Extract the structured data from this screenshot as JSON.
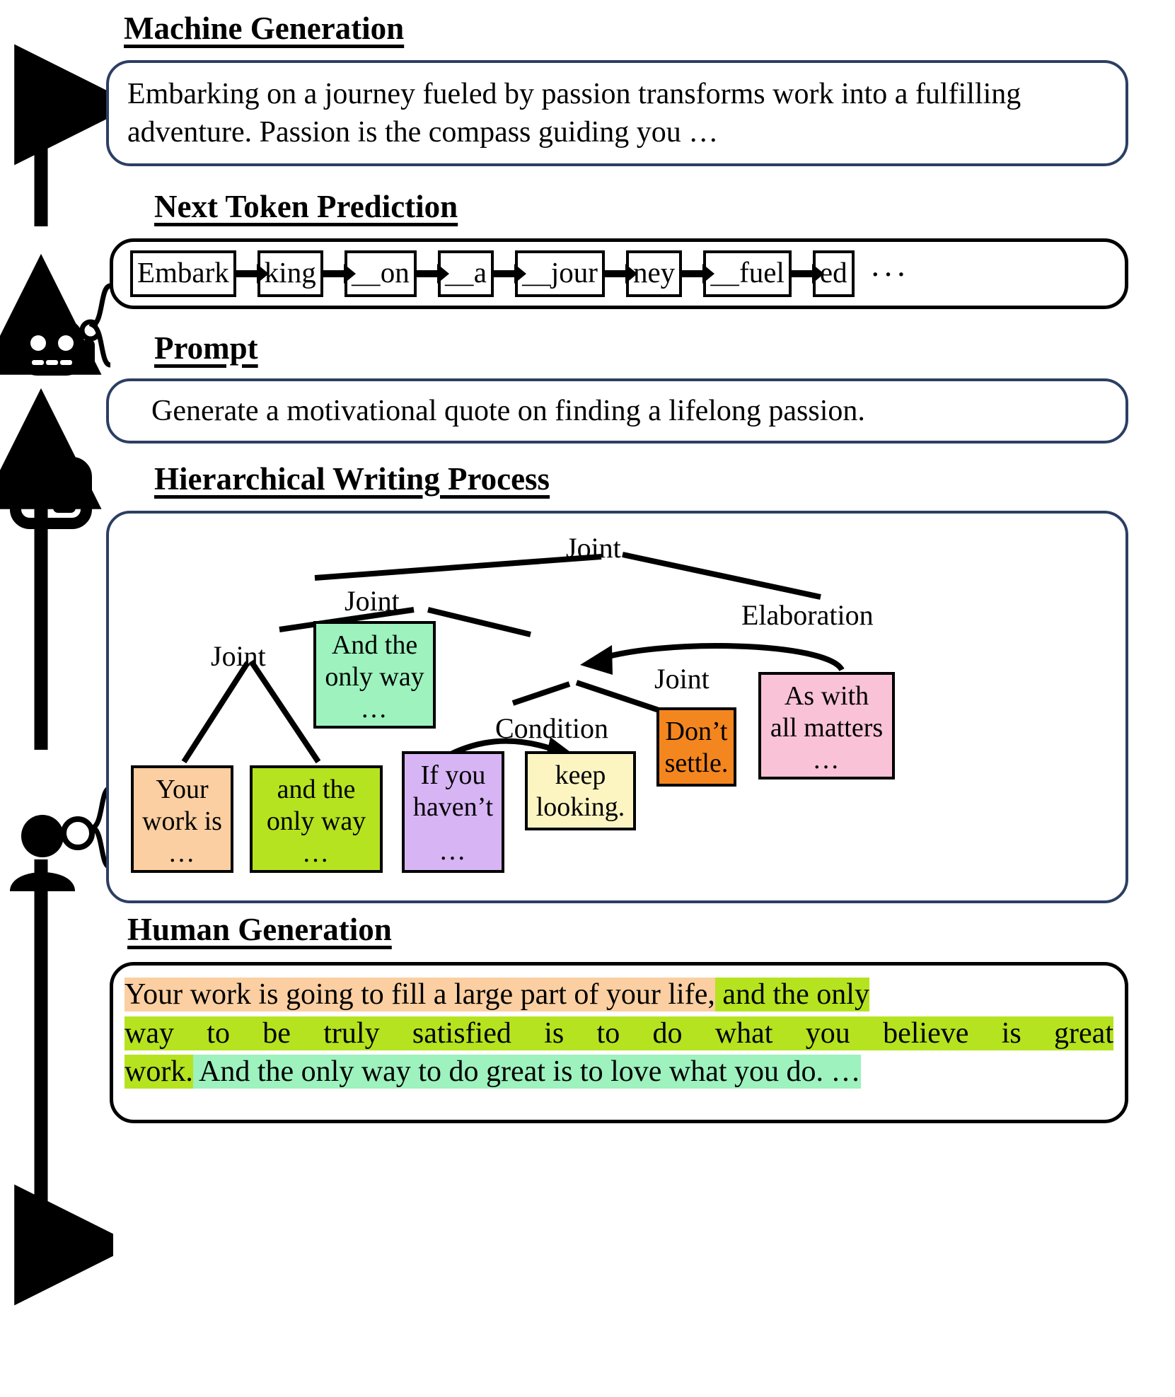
{
  "sections": {
    "machine_generation": {
      "heading": "Machine Generation",
      "text": "Embarking on a journey fueled by passion transforms work into a fulfilling adventure. Passion is the compass guiding you …"
    },
    "next_token_prediction": {
      "heading": "Next Token Prediction",
      "tokens": [
        "Embark",
        "king",
        "＿on",
        "＿a",
        "＿jour",
        "ney",
        "＿fuel",
        "ed"
      ],
      "ellipsis": "···"
    },
    "prompt": {
      "heading": "Prompt",
      "text": "Generate a motivational quote on finding a lifelong passion."
    },
    "hierarchical_writing_process": {
      "heading": "Hierarchical Writing Process",
      "nodes": {
        "root": "Joint",
        "left_mid": "Joint",
        "left_low": "Joint",
        "right_mid": "Joint",
        "elaboration": "Elaboration",
        "condition": "Condition"
      },
      "leaves": [
        {
          "id": "your-work-is",
          "lines": [
            "Your",
            "work is"
          ],
          "ellipsis": "…",
          "color": "#FBCFA1"
        },
        {
          "id": "and-the-only-way",
          "lines": [
            "and the",
            "only way"
          ],
          "ellipsis": "…",
          "color": "#B5E31F"
        },
        {
          "id": "And-the-only-way",
          "lines": [
            "And the",
            "only way"
          ],
          "ellipsis": "…",
          "color": "#9DF2BE"
        },
        {
          "id": "if-you-havent",
          "lines": [
            "If you",
            "haven’t"
          ],
          "ellipsis": "…",
          "color": "#D7B4F4"
        },
        {
          "id": "keep-looking",
          "lines": [
            "keep",
            "looking."
          ],
          "ellipsis": "",
          "color": "#FCF5C2"
        },
        {
          "id": "dont-settle",
          "lines": [
            "Don’t",
            "settle."
          ],
          "ellipsis": "",
          "color": "#F4861F"
        },
        {
          "id": "as-with-all-matters",
          "lines": [
            "As with",
            "all matters"
          ],
          "ellipsis": "…",
          "color": "#F9C2D7"
        }
      ]
    },
    "human_generation": {
      "heading": "Human Generation",
      "spans": [
        {
          "text": "Your work is going to fill a large part of your life,",
          "color": "#FBCFA1"
        },
        {
          "text": " ",
          "color": ""
        },
        {
          "text": "and the only way to be truly satisfied is to do what you believe is great work.",
          "color": "#B5E31F"
        },
        {
          "text": " ",
          "color": ""
        },
        {
          "text": "And the only way to do great is to love what you do.",
          "color": "#9DF2BE"
        },
        {
          "text": " …",
          "color": ""
        }
      ],
      "lines": [
        [
          {
            "text": "Your work is going to fill a large part of your life,",
            "color": "#FBCFA1"
          },
          {
            "text": " and the only",
            "color": "#B5E31F"
          }
        ],
        [
          {
            "text": "way to be truly satisfied is to do what you believe is great",
            "color": "#B5E31F"
          }
        ],
        [
          {
            "text": "work.",
            "color": "#B5E31F"
          },
          {
            "text": " And the only way to do great is to love what you do. …",
            "color": "#9DF2BE"
          }
        ]
      ]
    }
  },
  "icons": {
    "robot": "robot-icon",
    "terminal": "terminal-icon",
    "person": "person-icon"
  },
  "colors": {
    "panel_border": "#2c3e63",
    "stroke": "#000000"
  }
}
